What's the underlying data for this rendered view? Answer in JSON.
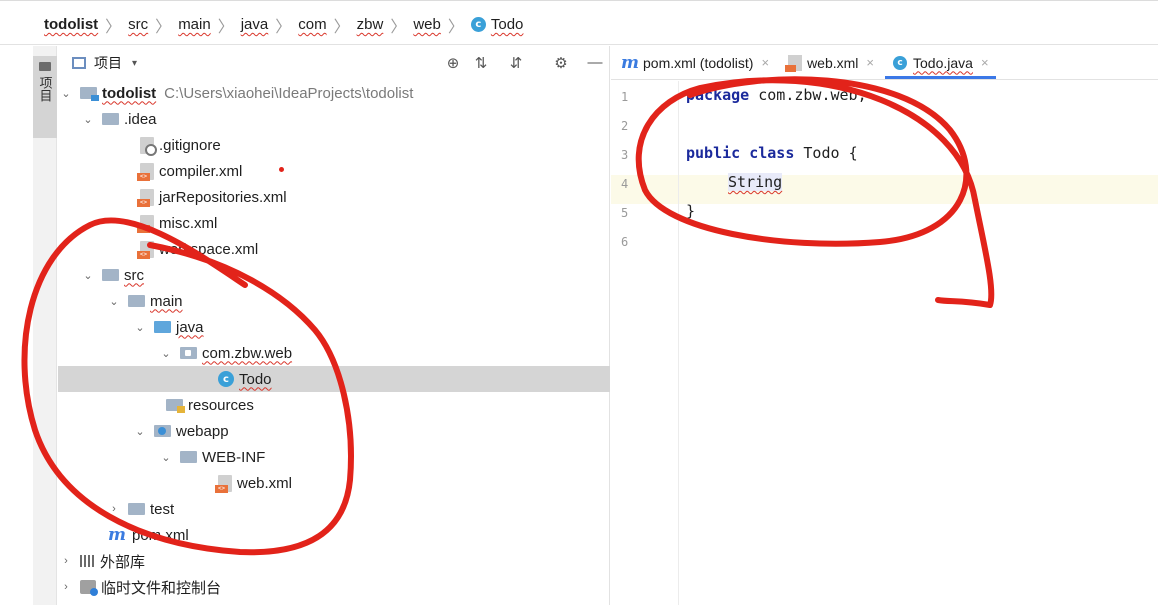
{
  "breadcrumb": [
    "todolist",
    "src",
    "main",
    "java",
    "com",
    "zbw",
    "web",
    "Todo"
  ],
  "sidebar_tab_label": "项目",
  "panel": {
    "view_label": "项目",
    "view_dropdown": "▾",
    "tools": [
      "locate-icon",
      "expand-all-icon",
      "collapse-all-icon",
      "settings-icon",
      "hide-icon"
    ],
    "tool_glyphs": [
      "⊕",
      "⇅",
      "⇵",
      "⚙",
      "—"
    ]
  },
  "tree": [
    {
      "label": "todolist",
      "hint": "C:\\Users\\xiaohei\\IdeaProjects\\todolist",
      "arrow": "⌄",
      "icon": "module-folder-icon"
    },
    {
      "label": ".idea",
      "arrow": "⌄",
      "icon": "folder-icon"
    },
    {
      "label": ".gitignore",
      "icon": "gitignore-file-icon"
    },
    {
      "label": "compiler.xml",
      "icon": "xml-file-icon"
    },
    {
      "label": "jarRepositories.xml",
      "icon": "xml-file-icon"
    },
    {
      "label": "misc.xml",
      "icon": "xml-file-icon"
    },
    {
      "label": "workspace.xml",
      "icon": "xml-file-icon"
    },
    {
      "label": "src",
      "arrow": "⌄",
      "icon": "folder-icon"
    },
    {
      "label": "main",
      "arrow": "⌄",
      "icon": "folder-icon"
    },
    {
      "label": "java",
      "arrow": "⌄",
      "icon": "source-folder-icon"
    },
    {
      "label": "com.zbw.web",
      "arrow": "⌄",
      "icon": "package-icon"
    },
    {
      "label": "Todo",
      "icon": "class-icon",
      "selected": true
    },
    {
      "label": "resources",
      "icon": "resources-folder-icon"
    },
    {
      "label": "webapp",
      "arrow": "⌄",
      "icon": "web-folder-icon"
    },
    {
      "label": "WEB-INF",
      "arrow": "⌄",
      "icon": "folder-icon"
    },
    {
      "label": "web.xml",
      "icon": "webxml-file-icon"
    },
    {
      "label": "test",
      "arrow": "›",
      "icon": "folder-icon"
    },
    {
      "label": "pom.xml",
      "icon": "maven-icon"
    },
    {
      "label": "外部库",
      "arrow": "›",
      "icon": "library-icon"
    },
    {
      "label": "临时文件和控制台",
      "arrow": "›",
      "icon": "scratches-icon"
    }
  ],
  "tabs": [
    {
      "label": "pom.xml (todolist)",
      "icon": "maven-icon",
      "close": "×"
    },
    {
      "label": "web.xml",
      "icon": "webxml-file-icon",
      "close": "×"
    },
    {
      "label": "Todo.java",
      "icon": "class-icon",
      "close": "×",
      "active": true
    }
  ],
  "line_numbers": [
    "1",
    "2",
    "3",
    "4",
    "5",
    "6"
  ],
  "code": {
    "line1_kw": "package",
    "line1_rest": " com.zbw.web;",
    "line3_kw1": "public",
    "line3_kw2": "class",
    "line3_name": "Todo",
    "line3_brace": "{",
    "line4": "String",
    "line5": "}"
  },
  "icon_glyph_class": "c",
  "icon_glyph_maven": "m",
  "colors": {
    "annotation_red": "#e2231a",
    "keyword": "#1b2a9c",
    "accent": "#3b78e7"
  }
}
